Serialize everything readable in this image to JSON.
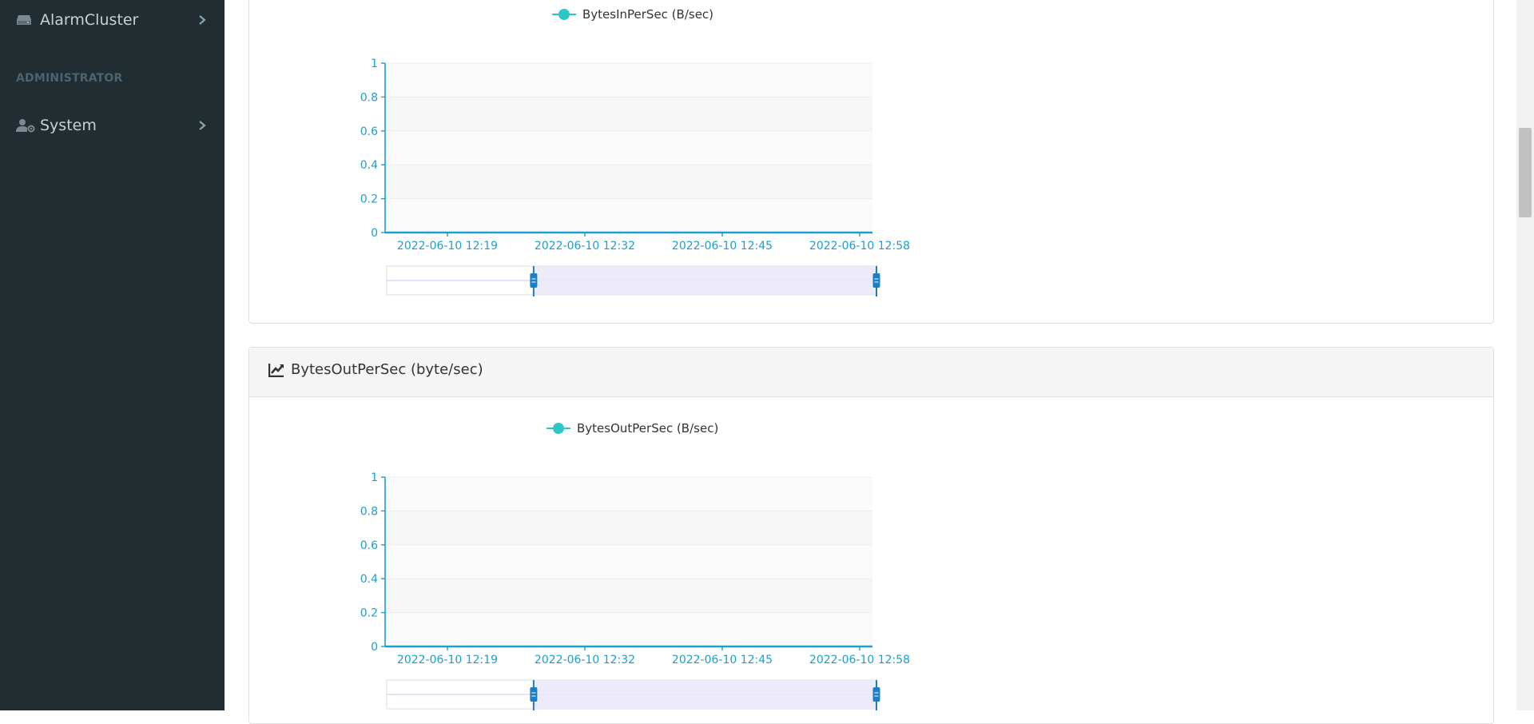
{
  "sidebar": {
    "items": [
      {
        "label": "AlarmCluster",
        "icon": "server-icon"
      },
      {
        "label": "System",
        "icon": "user-cog-icon"
      }
    ],
    "section_header": "ADMINISTRATOR"
  },
  "panels": [
    {
      "title": "",
      "chart_data": {
        "type": "line",
        "series": [
          {
            "name": "BytesInPerSec (B/sec)",
            "values": []
          }
        ],
        "x_ticks": [
          "2022-06-10 12:19",
          "2022-06-10 12:32",
          "2022-06-10 12:45",
          "2022-06-10 12:58"
        ],
        "y_ticks": [
          "0",
          "0.2",
          "0.4",
          "0.6",
          "0.8",
          "1"
        ],
        "ylim": [
          0,
          1
        ],
        "grid": "horizontal bands",
        "legend": "top",
        "data_zoom": {
          "start": 0.3,
          "end": 1.0
        }
      }
    },
    {
      "title": "BytesOutPerSec (byte/sec)",
      "chart_data": {
        "type": "line",
        "series": [
          {
            "name": "BytesOutPerSec (B/sec)",
            "values": []
          }
        ],
        "x_ticks": [
          "2022-06-10 12:19",
          "2022-06-10 12:32",
          "2022-06-10 12:45",
          "2022-06-10 12:58"
        ],
        "y_ticks": [
          "0",
          "0.2",
          "0.4",
          "0.6",
          "0.8",
          "1"
        ],
        "ylim": [
          0,
          1
        ],
        "grid": "horizontal bands",
        "legend": "top",
        "data_zoom": {
          "start": 0.3,
          "end": 1.0
        }
      }
    }
  ],
  "colors": {
    "axis": "#1a9fd0",
    "series": "#2ec7c9",
    "sidebar_bg": "#222d32",
    "zoom_fill": "#ebe8f8"
  }
}
